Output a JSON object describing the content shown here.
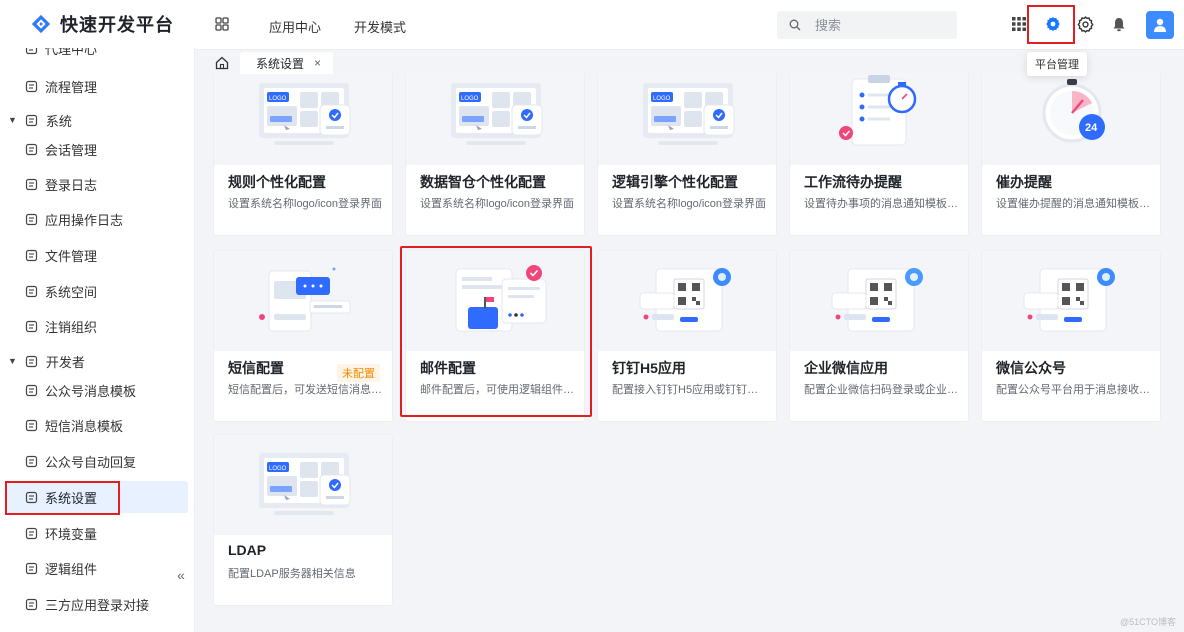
{
  "brand": {
    "name": "快速开发平台",
    "logo_icon": "diamond-logo-icon"
  },
  "sidebar": {
    "items": [
      {
        "label": "代理中心",
        "icon": "proxy-icon",
        "type": "child"
      },
      {
        "label": "流程管理",
        "icon": "flow-icon",
        "type": "child"
      },
      {
        "label": "系统",
        "icon": "system-icon",
        "type": "group"
      },
      {
        "label": "会话管理",
        "icon": "session-icon",
        "type": "child"
      },
      {
        "label": "登录日志",
        "icon": "login-log-icon",
        "type": "child"
      },
      {
        "label": "应用操作日志",
        "icon": "op-log-icon",
        "type": "child"
      },
      {
        "label": "文件管理",
        "icon": "folder-icon",
        "type": "child"
      },
      {
        "label": "系统空间",
        "icon": "space-icon",
        "type": "child"
      },
      {
        "label": "注销组织",
        "icon": "org-icon",
        "type": "child"
      },
      {
        "label": "开发者",
        "icon": "developer-icon",
        "type": "group"
      },
      {
        "label": "公众号消息模板",
        "icon": "template-icon",
        "type": "child"
      },
      {
        "label": "短信消息模板",
        "icon": "sms-template-icon",
        "type": "child"
      },
      {
        "label": "公众号自动回复",
        "icon": "auto-reply-icon",
        "type": "child"
      },
      {
        "label": "系统设置",
        "icon": "settings-icon",
        "type": "child",
        "active": true
      },
      {
        "label": "环境变量",
        "icon": "env-icon",
        "type": "child"
      },
      {
        "label": "逻辑组件",
        "icon": "logic-icon",
        "type": "child"
      },
      {
        "label": "三方应用登录对接",
        "icon": "third-party-icon",
        "type": "child"
      }
    ],
    "collapse_label": "«"
  },
  "topbar": {
    "nav": [
      "应用中心",
      "开发模式"
    ],
    "search_placeholder": "搜索",
    "tooltip": "平台管理"
  },
  "tabs": {
    "active_label": "系统设置",
    "close": "×"
  },
  "cards": [
    {
      "title": "规则个性化配置",
      "desc": "设置系统名称logo/icon登录界面",
      "illus": "logo"
    },
    {
      "title": "数据智仓个性化配置",
      "desc": "设置系统名称logo/icon登录界面",
      "illus": "logo"
    },
    {
      "title": "逻辑引擎个性化配置",
      "desc": "设置系统名称logo/icon登录界面",
      "illus": "logo"
    },
    {
      "title": "工作流待办提醒",
      "desc": "设置待办事项的消息通知模板，…",
      "illus": "clipboard"
    },
    {
      "title": "催办提醒",
      "desc": "设置催办提醒的消息通知模板，…",
      "illus": "timer"
    },
    {
      "title": "短信配置",
      "desc": "短信配置后，可发送短信消息，…",
      "illus": "sms",
      "badge": "未配置"
    },
    {
      "title": "邮件配置",
      "desc": "邮件配置后，可使用逻辑组件灵…",
      "illus": "mail"
    },
    {
      "title": "钉钉H5应用",
      "desc": "配置接入钉钉H5应用或钉钉扫码…",
      "illus": "qr-ding"
    },
    {
      "title": "企业微信应用",
      "desc": "配置企业微信扫码登录或企业微…",
      "illus": "qr-wework"
    },
    {
      "title": "微信公众号",
      "desc": "配置公众号平台用于消息接收发…",
      "illus": "qr-wechat"
    },
    {
      "title": "LDAP",
      "desc": "配置LDAP服务器相关信息",
      "illus": "logo"
    }
  ],
  "watermark": "@51CTO博客"
}
